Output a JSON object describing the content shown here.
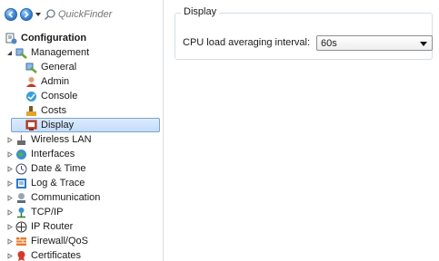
{
  "toolbar": {
    "back_icon": "back-arrow-icon",
    "forward_icon": "forward-arrow-icon",
    "quickfinder_placeholder": "QuickFinder"
  },
  "tree": {
    "root_label": "Configuration",
    "management_label": "Management",
    "management_children": [
      "General",
      "Admin",
      "Console",
      "Costs",
      "Display"
    ],
    "selected_item": "Display",
    "top_level_items": [
      "Wireless LAN",
      "Interfaces",
      "Date & Time",
      "Log & Trace",
      "Communication",
      "TCP/IP",
      "IP Router",
      "Firewall/QoS",
      "Certificates"
    ]
  },
  "content": {
    "group_title": "Display",
    "field_label": "CPU load averaging interval:",
    "field_value": "60s"
  },
  "colors": {
    "selection_fill": "#c4ddfb",
    "selection_border": "#7da2ce",
    "pane_border": "#d7dce3"
  }
}
